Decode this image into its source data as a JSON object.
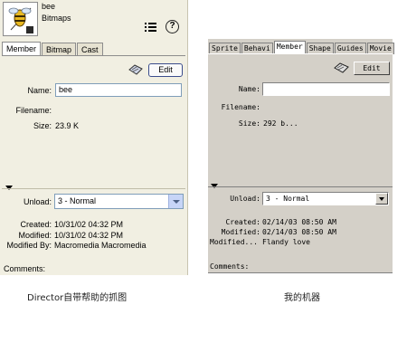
{
  "left_panel": {
    "member_name": "bee",
    "member_type": "Bitmaps",
    "tabs": [
      "Member",
      "Bitmap",
      "Cast"
    ],
    "edit_label": "Edit",
    "name_label": "Name:",
    "name_value": "bee",
    "filename_label": "Filename:",
    "size_label": "Size:",
    "size_value": "23.9 K",
    "unload_label": "Unload:",
    "unload_value": "3 - Normal",
    "created_label": "Created:",
    "created_value": "10/31/02 04:32 PM",
    "modified_label": "Modified:",
    "modified_value": "10/31/02 04:32 PM",
    "modified_by_label": "Modified By:",
    "modified_by_value": "Macromedia Macromedia",
    "comments_label": "Comments:"
  },
  "right_panel": {
    "tabs": [
      "Sprite",
      "Behavi",
      "Member",
      "Shape",
      "Guides",
      "Movie"
    ],
    "edit_label": "Edit",
    "name_label": "Name:",
    "filename_label": "Filename:",
    "size_label": "Size:",
    "size_value": "292 b...",
    "unload_label": "Unload:",
    "unload_value": "3 - Normal",
    "created_label": "Created:",
    "created_value": "02/14/03 08:50 AM",
    "modified_label": "Modified:",
    "modified_value": "02/14/03 08:50 AM",
    "modified_by_label": "Modified...",
    "modified_by_value": "Flandy love",
    "comments_label": "Comments:"
  },
  "captions": {
    "left": "Director自带帮助的抓图",
    "right": "我的机器"
  },
  "icons": {
    "thumbnail": "bee-thumbnail-icon",
    "list": "list-view-icon",
    "help": "help-icon",
    "edit": "edit-member-icon"
  }
}
